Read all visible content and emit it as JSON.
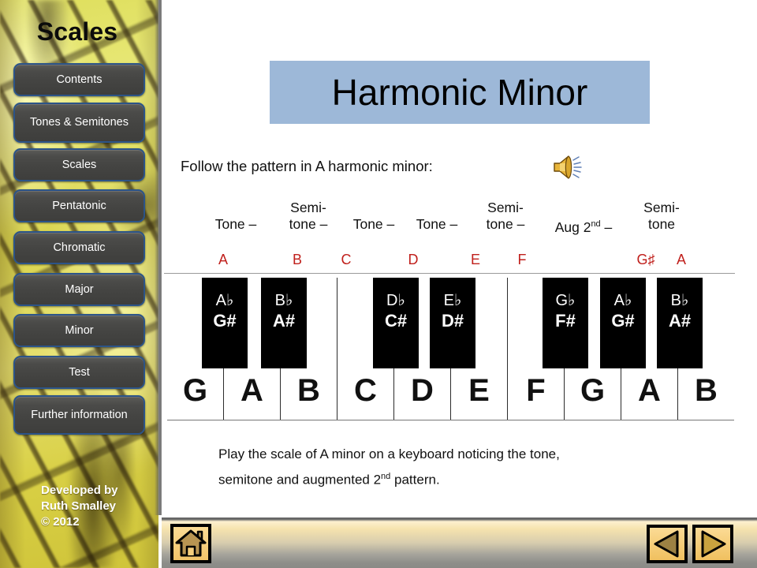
{
  "sidebar": {
    "brand": "Scales",
    "items": [
      {
        "label": "Contents",
        "name": "contents"
      },
      {
        "label": "Tones & Semitones",
        "name": "tones-semitones"
      },
      {
        "label": "Scales",
        "name": "scales"
      },
      {
        "label": "Pentatonic",
        "name": "pentatonic"
      },
      {
        "label": "Chromatic",
        "name": "chromatic"
      },
      {
        "label": "Major",
        "name": "major"
      },
      {
        "label": "Minor",
        "name": "minor"
      },
      {
        "label": "Test",
        "name": "test"
      },
      {
        "label": "Further information",
        "name": "further-information"
      }
    ],
    "credits": {
      "line1": "Developed by",
      "line2": "Ruth Smalley",
      "line3": "© 2012"
    }
  },
  "main": {
    "title": "Harmonic Minor",
    "title_bg": "#9db8d8",
    "lead_text": "Follow the pattern in A harmonic minor:",
    "speaker_icon": "speaker-icon",
    "closing_line1": "Play the scale of A minor on a keyboard noticing the tone,",
    "closing_line2a": "semitone  and augmented 2",
    "closing_line2sup": "nd",
    "closing_line2b": " pattern."
  },
  "chart_data": {
    "type": "table",
    "title": "A harmonic minor scale — interval pattern over a piano keyboard",
    "note_color": "#c0201c",
    "intervals": [
      {
        "line1": "",
        "line2": "Tone –"
      },
      {
        "line1": "Semi-",
        "line2": "tone –"
      },
      {
        "line1": "",
        "line2": "Tone –"
      },
      {
        "line1": "",
        "line2": "Tone –"
      },
      {
        "line1": "Semi-",
        "line2": "tone –"
      },
      {
        "line1": "",
        "line2": "Aug 2",
        "sup": "nd",
        "after": " –"
      },
      {
        "line1": "Semi-",
        "line2": "tone"
      }
    ],
    "notes": [
      "A",
      "B",
      "C",
      "D",
      "E",
      "F",
      "G♯",
      "A"
    ],
    "keyboard": {
      "white_keys": [
        "G",
        "A",
        "B",
        "C",
        "D",
        "E",
        "F",
        "G",
        "A",
        "B"
      ],
      "black_keys": [
        {
          "flat": "A♭",
          "sharp": "G#"
        },
        {
          "flat": "B♭",
          "sharp": "A#"
        },
        {
          "flat": "D♭",
          "sharp": "C#"
        },
        {
          "flat": "E♭",
          "sharp": "D#"
        },
        {
          "flat": "G♭",
          "sharp": "F#"
        },
        {
          "flat": "A♭",
          "sharp": "G#"
        },
        {
          "flat": "B♭",
          "sharp": "A#"
        }
      ]
    }
  },
  "bottombar": {
    "home_icon": "home-icon",
    "back_icon": "triangle-left-icon",
    "forward_icon": "triangle-right-icon"
  }
}
